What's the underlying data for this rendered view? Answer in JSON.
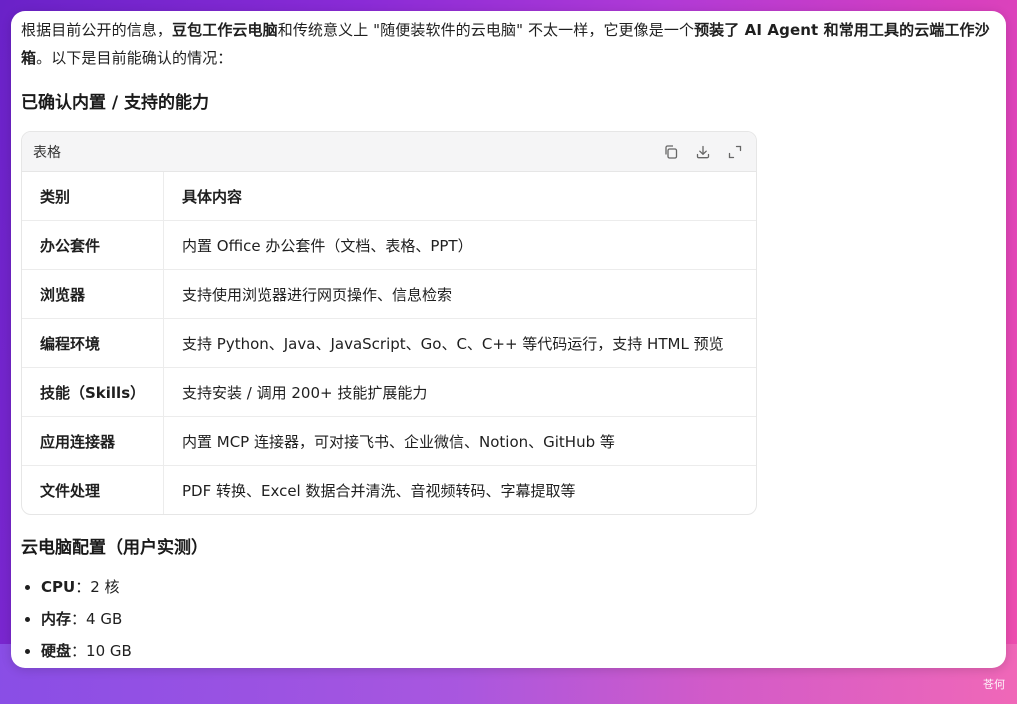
{
  "intro": {
    "p1": "根据目前公开的信息，",
    "b1": "豆包工作云电脑",
    "p2": "和传统意义上 \"随便装软件的云电脑\" 不太一样，它更像是一个",
    "b2": "预装了 AI Agent 和常用工具的云端工作沙箱",
    "p3": "。以下是目前能确认的情况："
  },
  "section1": {
    "title": "已确认内置 / 支持的能力"
  },
  "table": {
    "label": "表格",
    "tools": [
      "copy-icon",
      "download-icon",
      "expand-icon"
    ],
    "headers": [
      "类别",
      "具体内容"
    ],
    "rows": [
      {
        "category": "办公套件",
        "detail": "内置 Office 办公套件（文档、表格、PPT）"
      },
      {
        "category": "浏览器",
        "detail": "支持使用浏览器进行网页操作、信息检索"
      },
      {
        "category": "编程环境",
        "detail": "支持 Python、Java、JavaScript、Go、C、C++ 等代码运行，支持 HTML 预览"
      },
      {
        "category": "技能（Skills）",
        "detail": "支持安装 / 调用 200+ 技能扩展能力"
      },
      {
        "category": "应用连接器",
        "detail": "内置 MCP 连接器，可对接飞书、企业微信、Notion、GitHub 等"
      },
      {
        "category": "文件处理",
        "detail": "PDF 转换、Excel 数据合并清洗、音视频转码、字幕提取等"
      }
    ]
  },
  "section2": {
    "title": "云电脑配置（用户实测）",
    "specs": [
      {
        "key": "CPU",
        "sep": "：",
        "value": "2 核"
      },
      {
        "key": "内存",
        "sep": "：",
        "value": "4 GB"
      },
      {
        "key": "硬盘",
        "sep": "：",
        "value": "10 GB"
      }
    ]
  },
  "watermark": "苍何"
}
